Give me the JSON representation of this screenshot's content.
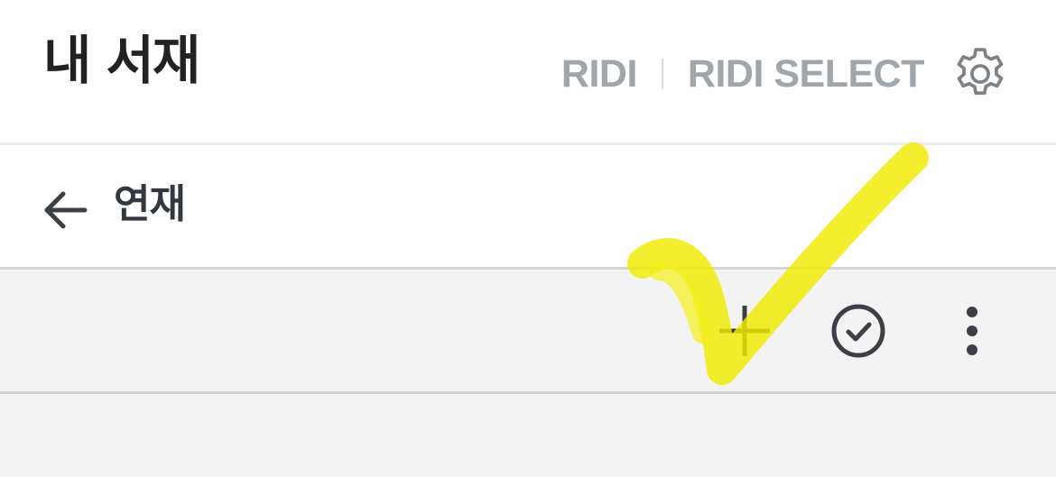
{
  "header": {
    "title": "내 서재",
    "store_links": [
      "RIDI",
      "RIDI SELECT"
    ]
  },
  "icons": {
    "settings": "gear-icon",
    "back": "arrow-left-icon",
    "add": "plus-icon",
    "select": "check-circle-icon",
    "more": "more-vertical-icon",
    "annotation": "yellow-checkmark-marker"
  },
  "subheader": {
    "title": "연재"
  },
  "colors": {
    "header_bg": "#ffffff",
    "toolbar_bg": "#f3f3f3",
    "title_text": "#222222",
    "store_link_text": "#a1a6aa",
    "icon": "#3c4046",
    "annotation_marker": "#f2ec00"
  }
}
